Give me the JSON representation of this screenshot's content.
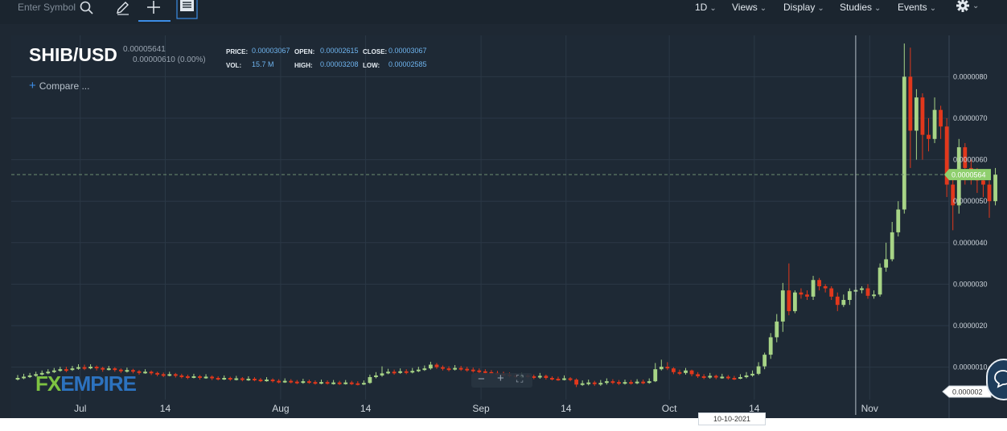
{
  "toolbar": {
    "search_placeholder": "Enter Symbol",
    "menus": [
      "1D",
      "Views",
      "Display",
      "Studies",
      "Events"
    ],
    "icons": [
      "search-icon",
      "pencil-icon",
      "crosshair-icon",
      "news-icon",
      "gear-icon"
    ]
  },
  "header": {
    "pair": "SHIB/USD",
    "last": "0.00005641",
    "change": "0.00000610 (0.00%)",
    "price_label": "PRICE:",
    "price": "0.00003067",
    "open_label": "OPEN:",
    "open": "0.00002615",
    "close_label": "CLOSE:",
    "close": "0.00003067",
    "vol_label": "VOL:",
    "vol": "15.7 M",
    "high_label": "HIGH:",
    "high": "0.00003208",
    "low_label": "LOW:",
    "low": "0.00002585",
    "compare": "Compare ..."
  },
  "branding": {
    "logo": "FXEMPIRE"
  },
  "crosshair": {
    "date": "10-10-2021"
  },
  "zoom_controls": [
    "−",
    "+",
    "⛶"
  ],
  "colors": {
    "up": "#a7d486",
    "down": "#e2381c",
    "background": "#1e2935",
    "grid": "#2b3846",
    "axis_text": "#d0d7de",
    "price_tag": "#8fcf6e"
  },
  "chart_data": {
    "type": "candlestick",
    "title": "SHIB/USD",
    "x_tick_labels": [
      "Jul",
      "14",
      "Aug",
      "14",
      "Sep",
      "14",
      "Oct",
      "14",
      "Nov"
    ],
    "y_tick_labels": [
      "0.0000080",
      "0.0000070",
      "0.0000060",
      "0.0000050",
      "0.0000040",
      "0.0000030",
      "0.0000020",
      "0.0000010"
    ],
    "current_price_label": "0.0000564",
    "low_price_label": "0.000002",
    "ylim": [
      2e-07,
      8.9e-06
    ],
    "current_price": 5.64e-06,
    "crosshair_index": 138,
    "candles": [
      [
        7.2e-07,
        7.4e-07,
        8.1e-07,
        6.8e-07
      ],
      [
        7.4e-07,
        7.7e-07,
        8.4e-07,
        7.1e-07
      ],
      [
        7.7e-07,
        8e-07,
        8.6e-07,
        7.4e-07
      ],
      [
        8e-07,
        8.3e-07,
        8.9e-07,
        7.7e-07
      ],
      [
        8.3e-07,
        8.6e-07,
        9.2e-07,
        8e-07
      ],
      [
        8.6e-07,
        8.9e-07,
        9.5e-07,
        8.3e-07
      ],
      [
        8.9e-07,
        9.2e-07,
        9.8e-07,
        8.6e-07
      ],
      [
        9.2e-07,
        9.5e-07,
        1.01e-06,
        8.9e-07
      ],
      [
        9.5e-07,
        9.4e-07,
        1.01e-06,
        8.8e-07
      ],
      [
        9.4e-07,
        9.7e-07,
        1.03e-06,
        9.1e-07
      ],
      [
        9.7e-07,
        1e-06,
        1.07e-06,
        9.4e-07
      ],
      [
        1e-06,
        9.9e-07,
        1.06e-06,
        9.3e-07
      ],
      [
        9.9e-07,
        1.01e-06,
        1.07e-06,
        9.5e-07
      ],
      [
        1.01e-06,
        9.8e-07,
        1.04e-06,
        9.2e-07
      ],
      [
        9.8e-07,
        9.5e-07,
        1.01e-06,
        8.9e-07
      ],
      [
        9.5e-07,
        9.7e-07,
        1.03e-06,
        9.2e-07
      ],
      [
        9.7e-07,
        9.4e-07,
        1e-06,
        8.9e-07
      ],
      [
        9.4e-07,
        9.1e-07,
        9.7e-07,
        8.6e-07
      ],
      [
        9.1e-07,
        9.3e-07,
        9.9e-07,
        8.7e-07
      ],
      [
        9.3e-07,
        9e-07,
        9.6e-07,
        8.5e-07
      ],
      [
        9e-07,
        8.7e-07,
        9.3e-07,
        8.2e-07
      ],
      [
        8.7e-07,
        8.9e-07,
        9.5e-07,
        8.4e-07
      ],
      [
        8.9e-07,
        8.6e-07,
        9.2e-07,
        8.1e-07
      ],
      [
        8.6e-07,
        8.3e-07,
        8.9e-07,
        7.8e-07
      ],
      [
        8.3e-07,
        8.1e-07,
        8.7e-07,
        7.6e-07
      ],
      [
        8.1e-07,
        8.3e-07,
        8.9e-07,
        7.8e-07
      ],
      [
        8.3e-07,
        8e-07,
        8.6e-07,
        7.5e-07
      ],
      [
        8e-07,
        7.8e-07,
        8.4e-07,
        7.3e-07
      ],
      [
        7.8e-07,
        7.6e-07,
        8.2e-07,
        7.1e-07
      ],
      [
        7.6e-07,
        7.8e-07,
        8.4e-07,
        7.3e-07
      ],
      [
        7.8e-07,
        7.5e-07,
        8.1e-07,
        7e-07
      ],
      [
        7.5e-07,
        7.7e-07,
        8.3e-07,
        7.2e-07
      ],
      [
        7.7e-07,
        7.4e-07,
        8e-07,
        6.9e-07
      ],
      [
        7.4e-07,
        7.2e-07,
        7.8e-07,
        6.8e-07
      ],
      [
        7.2e-07,
        7.4e-07,
        8e-07,
        6.9e-07
      ],
      [
        7.4e-07,
        7.1e-07,
        7.7e-07,
        6.7e-07
      ],
      [
        7.1e-07,
        7.3e-07,
        7.9e-07,
        6.8e-07
      ],
      [
        7.3e-07,
        7e-07,
        7.6e-07,
        6.6e-07
      ],
      [
        7e-07,
        7.2e-07,
        7.8e-07,
        6.7e-07
      ],
      [
        7.2e-07,
        7e-07,
        7.6e-07,
        6.6e-07
      ],
      [
        7e-07,
        6.8e-07,
        7.4e-07,
        6.4e-07
      ],
      [
        6.8e-07,
        7e-07,
        7.6e-07,
        6.5e-07
      ],
      [
        7e-07,
        6.7e-07,
        7.3e-07,
        6.3e-07
      ],
      [
        6.7e-07,
        6.5e-07,
        7.1e-07,
        6.1e-07
      ],
      [
        6.5e-07,
        6.7e-07,
        7.3e-07,
        6.2e-07
      ],
      [
        6.7e-07,
        6.5e-07,
        7.1e-07,
        6.1e-07
      ],
      [
        6.5e-07,
        6.3e-07,
        6.9e-07,
        5.9e-07
      ],
      [
        6.3e-07,
        6.6e-07,
        7.2e-07,
        6e-07
      ],
      [
        6.6e-07,
        6.4e-07,
        7e-07,
        6e-07
      ],
      [
        6.4e-07,
        6.2e-07,
        6.8e-07,
        5.8e-07
      ],
      [
        6.2e-07,
        6.4e-07,
        7e-07,
        5.9e-07
      ],
      [
        6.4e-07,
        6.2e-07,
        6.8e-07,
        5.8e-07
      ],
      [
        6.2e-07,
        6.3e-07,
        6.9e-07,
        5.8e-07
      ],
      [
        6.3e-07,
        6.1e-07,
        6.7e-07,
        5.7e-07
      ],
      [
        6.1e-07,
        6.3e-07,
        6.9e-07,
        5.8e-07
      ],
      [
        6.3e-07,
        6.1e-07,
        6.7e-07,
        5.7e-07
      ],
      [
        6.1e-07,
        6e-07,
        6.6e-07,
        5.6e-07
      ],
      [
        6e-07,
        6.2e-07,
        6.8e-07,
        5.7e-07
      ],
      [
        6.2e-07,
        7.6e-07,
        8.2e-07,
        6e-07
      ],
      [
        7.6e-07,
        8e-07,
        8.8e-07,
        7.3e-07
      ],
      [
        8e-07,
        8.5e-07,
        1.02e-06,
        7.7e-07
      ],
      [
        8.5e-07,
        8.9e-07,
        9.6e-07,
        8.3e-07
      ],
      [
        8.9e-07,
        8.7e-07,
        9.4e-07,
        8.2e-07
      ],
      [
        8.7e-07,
        9e-07,
        9.7e-07,
        8.4e-07
      ],
      [
        9e-07,
        8.8e-07,
        9.5e-07,
        8.3e-07
      ],
      [
        8.8e-07,
        9.1e-07,
        9.8e-07,
        8.5e-07
      ],
      [
        9.1e-07,
        9.4e-07,
        1.01e-06,
        8.8e-07
      ],
      [
        9.4e-07,
        9.7e-07,
        1.04e-06,
        9.1e-07
      ],
      [
        9.7e-07,
        1.06e-06,
        1.13e-06,
        9.4e-07
      ],
      [
        1.06e-06,
        1e-06,
        1.1e-06,
        9.6e-07
      ],
      [
        1e-06,
        9.7e-07,
        1.04e-06,
        9.2e-07
      ],
      [
        9.7e-07,
        9.5e-07,
        1.02e-06,
        9e-07
      ],
      [
        9.5e-07,
        9.8e-07,
        1.05e-06,
        9.2e-07
      ],
      [
        9.8e-07,
        9.6e-07,
        1.03e-06,
        9.1e-07
      ],
      [
        9.6e-07,
        9.4e-07,
        1.01e-06,
        8.9e-07
      ],
      [
        9.4e-07,
        9.2e-07,
        9.9e-07,
        8.7e-07
      ],
      [
        9.2e-07,
        9e-07,
        9.7e-07,
        8.5e-07
      ],
      [
        9e-07,
        8.8e-07,
        9.5e-07,
        8.3e-07
      ],
      [
        8.8e-07,
        8.6e-07,
        9.3e-07,
        8.1e-07
      ],
      [
        8.6e-07,
        8.4e-07,
        9.1e-07,
        7.9e-07
      ],
      [
        8.4e-07,
        8.2e-07,
        8.9e-07,
        7.7e-07
      ],
      [
        8.2e-07,
        8e-07,
        8.7e-07,
        7.5e-07
      ],
      [
        8e-07,
        7.8e-07,
        8.5e-07,
        7.3e-07
      ],
      [
        7.8e-07,
        8e-07,
        8.6e-07,
        7.3e-07
      ],
      [
        8e-07,
        7.8e-07,
        8.4e-07,
        7.3e-07
      ],
      [
        7.8e-07,
        7.6e-07,
        8.2e-07,
        7.1e-07
      ],
      [
        7.6e-07,
        7.9e-07,
        8.6e-07,
        7.2e-07
      ],
      [
        7.9e-07,
        7.4e-07,
        8.2e-07,
        7e-07
      ],
      [
        7.4e-07,
        7.2e-07,
        7.8e-07,
        6.8e-07
      ],
      [
        7.2e-07,
        7.1e-07,
        7.7e-07,
        6.7e-07
      ],
      [
        7.1e-07,
        7.3e-07,
        8e-07,
        6.8e-07
      ],
      [
        7.3e-07,
        7e-07,
        7.6e-07,
        6.6e-07
      ],
      [
        7e-07,
        5.8e-07,
        7.3e-07,
        5.2e-07
      ],
      [
        5.8e-07,
        6.1e-07,
        6.8e-07,
        5.5e-07
      ],
      [
        6.1e-07,
        6.3e-07,
        7e-07,
        5.6e-07
      ],
      [
        6.3e-07,
        6e-07,
        6.7e-07,
        5.5e-07
      ],
      [
        6e-07,
        6.2e-07,
        6.9e-07,
        5.5e-07
      ],
      [
        6.2e-07,
        6.6e-07,
        7.3e-07,
        5.8e-07
      ],
      [
        6.6e-07,
        6.4e-07,
        7.1e-07,
        5.9e-07
      ],
      [
        6.4e-07,
        6.2e-07,
        6.9e-07,
        5.7e-07
      ],
      [
        6.2e-07,
        6.4e-07,
        7e-07,
        5.8e-07
      ],
      [
        6.4e-07,
        6.3e-07,
        6.9e-07,
        5.8e-07
      ],
      [
        6.3e-07,
        6.5e-07,
        7.1e-07,
        5.9e-07
      ],
      [
        6.5e-07,
        6.4e-07,
        7e-07,
        5.9e-07
      ],
      [
        6.4e-07,
        6.6e-07,
        7.3e-07,
        6e-07
      ],
      [
        6.6e-07,
        9.5e-07,
        1.1e-06,
        6.4e-07
      ],
      [
        9.5e-07,
        1.01e-06,
        1.18e-06,
        9.2e-07
      ],
      [
        1.01e-06,
        9.7e-07,
        1.12e-06,
        9.3e-07
      ],
      [
        9.7e-07,
        8.8e-07,
        1e-06,
        8.3e-07
      ],
      [
        8.8e-07,
        8.6e-07,
        9.4e-07,
        8.1e-07
      ],
      [
        8.6e-07,
        9.2e-07,
        9.8e-07,
        8.2e-07
      ],
      [
        9.2e-07,
        8.3e-07,
        9.4e-07,
        7.8e-07
      ],
      [
        8.3e-07,
        7.8e-07,
        8.8e-07,
        7.4e-07
      ],
      [
        7.8e-07,
        7.5e-07,
        8.3e-07,
        7.1e-07
      ],
      [
        7.5e-07,
        7.9e-07,
        8.6e-07,
        7.2e-07
      ],
      [
        7.9e-07,
        7.5e-07,
        8.2e-07,
        7.1e-07
      ],
      [
        7.5e-07,
        7.7e-07,
        8.4e-07,
        7.2e-07
      ],
      [
        7.7e-07,
        7.4e-07,
        8.1e-07,
        7e-07
      ],
      [
        7.4e-07,
        7.3e-07,
        7.9e-07,
        6.9e-07
      ],
      [
        7.3e-07,
        7.6e-07,
        8.3e-07,
        7.1e-07
      ],
      [
        7.6e-07,
        8e-07,
        8.8e-07,
        7.3e-07
      ],
      [
        8e-07,
        8.4e-07,
        9.2e-07,
        7.7e-07
      ],
      [
        8.4e-07,
        1.02e-06,
        1.12e-06,
        8.1e-07
      ],
      [
        1.02e-06,
        1.3e-06,
        1.35e-06,
        9.5e-07
      ],
      [
        1.3e-06,
        1.72e-06,
        1.82e-06,
        1.2e-06
      ],
      [
        1.72e-06,
        2.1e-06,
        2.28e-06,
        1.6e-06
      ],
      [
        2.1e-06,
        2.85e-06,
        3.03e-06,
        1.85e-06
      ],
      [
        2.85e-06,
        2.35e-06,
        3.5e-06,
        2.25e-06
      ],
      [
        2.35e-06,
        2.8e-06,
        2.85e-06,
        2.3e-06
      ],
      [
        2.8e-06,
        2.75e-06,
        2.9e-06,
        2.65e-06
      ],
      [
        2.75e-06,
        2.7e-06,
        2.85e-06,
        2.62e-06
      ],
      [
        2.7e-06,
        3.1e-06,
        3.2e-06,
        2.62e-06
      ],
      [
        3.1e-06,
        2.95e-06,
        3.15e-06,
        2.85e-06
      ],
      [
        2.95e-06,
        2.9e-06,
        3e-06,
        2.8e-06
      ],
      [
        2.9e-06,
        2.7e-06,
        2.95e-06,
        2.62e-06
      ],
      [
        2.7e-06,
        2.5e-06,
        2.8e-06,
        2.35e-06
      ],
      [
        2.5e-06,
        2.62e-06,
        2.75e-06,
        2.45e-06
      ],
      [
        2.62e-06,
        2.83e-06,
        2.9e-06,
        2.5e-06
      ],
      [
        2.83e-06,
        2.86e-06,
        2.93e-06,
        2.73e-06
      ],
      [
        2.86e-06,
        2.9e-06,
        2.95e-06,
        2.78e-06
      ],
      [
        2.9e-06,
        2.72e-06,
        3e-06,
        2.65e-06
      ],
      [
        2.72e-06,
        2.75e-06,
        2.85e-06,
        2.65e-06
      ],
      [
        2.75e-06,
        3.4e-06,
        3.5e-06,
        2.7e-06
      ],
      [
        3.4e-06,
        3.6e-06,
        4e-06,
        3.3e-06
      ],
      [
        3.6e-06,
        4.25e-06,
        4.5e-06,
        3.55e-06
      ],
      [
        4.25e-06,
        4.8e-06,
        5e-06,
        4.15e-06
      ],
      [
        4.8e-06,
        8e-06,
        8.8e-06,
        4.7e-06
      ],
      [
        8e-06,
        6.7e-06,
        8.7e-06,
        5.8e-06
      ],
      [
        6.7e-06,
        7.5e-06,
        7.7e-06,
        6e-06
      ],
      [
        7.5e-06,
        6.6e-06,
        7.6e-06,
        6e-06
      ],
      [
        6.6e-06,
        6.5e-06,
        7e-06,
        6.2e-06
      ],
      [
        6.5e-06,
        7.2e-06,
        7.5e-06,
        6.4e-06
      ],
      [
        7.2e-06,
        6.8e-06,
        7.3e-06,
        6.5e-06
      ],
      [
        6.8e-06,
        5.4e-06,
        7e-06,
        5.1e-06
      ],
      [
        5.4e-06,
        4.9e-06,
        5.6e-06,
        4.3e-06
      ],
      [
        4.9e-06,
        6.3e-06,
        6.5e-06,
        4.7e-06
      ],
      [
        6.3e-06,
        5.8e-06,
        6.4e-06,
        5.4e-06
      ],
      [
        5.8e-06,
        5.7e-06,
        6e-06,
        5.4e-06
      ],
      [
        5.7e-06,
        5.5e-06,
        5.8e-06,
        5.2e-06
      ],
      [
        5.5e-06,
        5.4e-06,
        5.6e-06,
        5.1e-06
      ],
      [
        5.4e-06,
        5e-06,
        5.5e-06,
        4.6e-06
      ],
      [
        5e-06,
        5.64e-06,
        5.8e-06,
        4.9e-06
      ]
    ]
  }
}
